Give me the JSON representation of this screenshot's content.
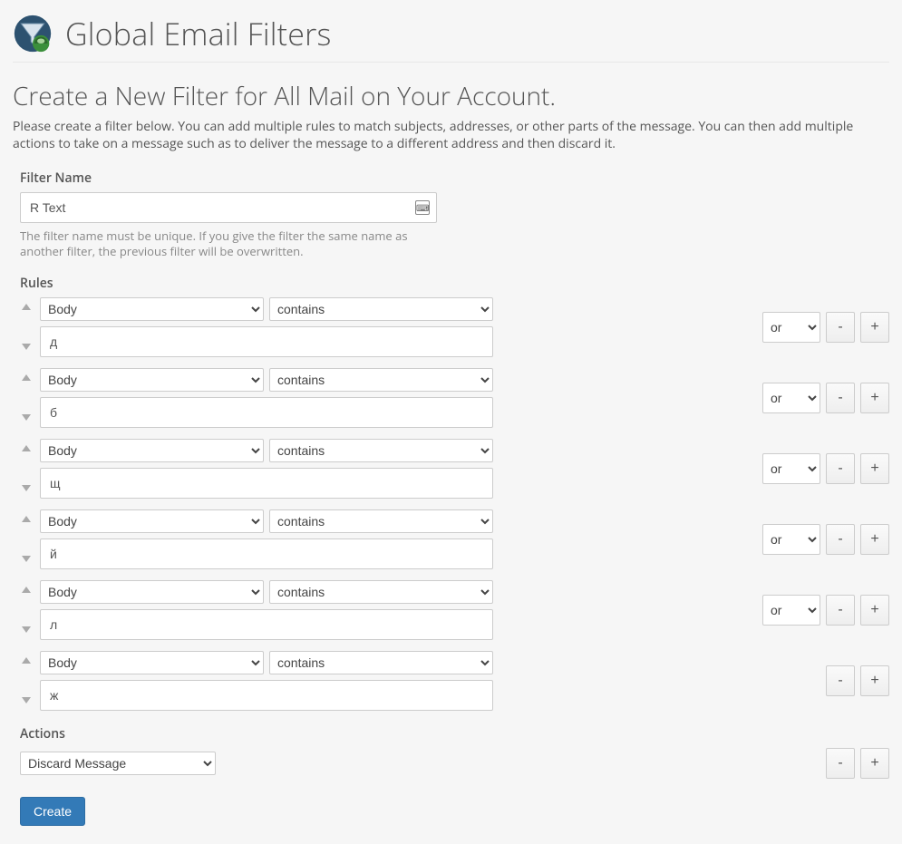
{
  "header": {
    "title": "Global Email Filters"
  },
  "subtitle": "Create a New Filter for All Mail on Your Account.",
  "description": "Please create a filter below. You can add multiple rules to match subjects, addresses, or other parts of the message. You can then add multiple actions to take on a message such as to deliver the message to a different address and then discard it.",
  "filter_name": {
    "label": "Filter Name",
    "value": "R Text",
    "hint": "The filter name must be unique. If you give the filter the same name as another filter, the previous filter will be overwritten."
  },
  "rules": {
    "label": "Rules",
    "items": [
      {
        "part": "Body",
        "match": "contains",
        "value": "д",
        "logic": "or"
      },
      {
        "part": "Body",
        "match": "contains",
        "value": "б",
        "logic": "or"
      },
      {
        "part": "Body",
        "match": "contains",
        "value": "щ",
        "logic": "or"
      },
      {
        "part": "Body",
        "match": "contains",
        "value": "й",
        "logic": "or"
      },
      {
        "part": "Body",
        "match": "contains",
        "value": "л",
        "logic": "or"
      },
      {
        "part": "Body",
        "match": "contains",
        "value": "ж",
        "logic": ""
      }
    ]
  },
  "actions": {
    "label": "Actions",
    "selected": "Discard Message"
  },
  "buttons": {
    "create": "Create",
    "remove": "-",
    "add": "+"
  }
}
